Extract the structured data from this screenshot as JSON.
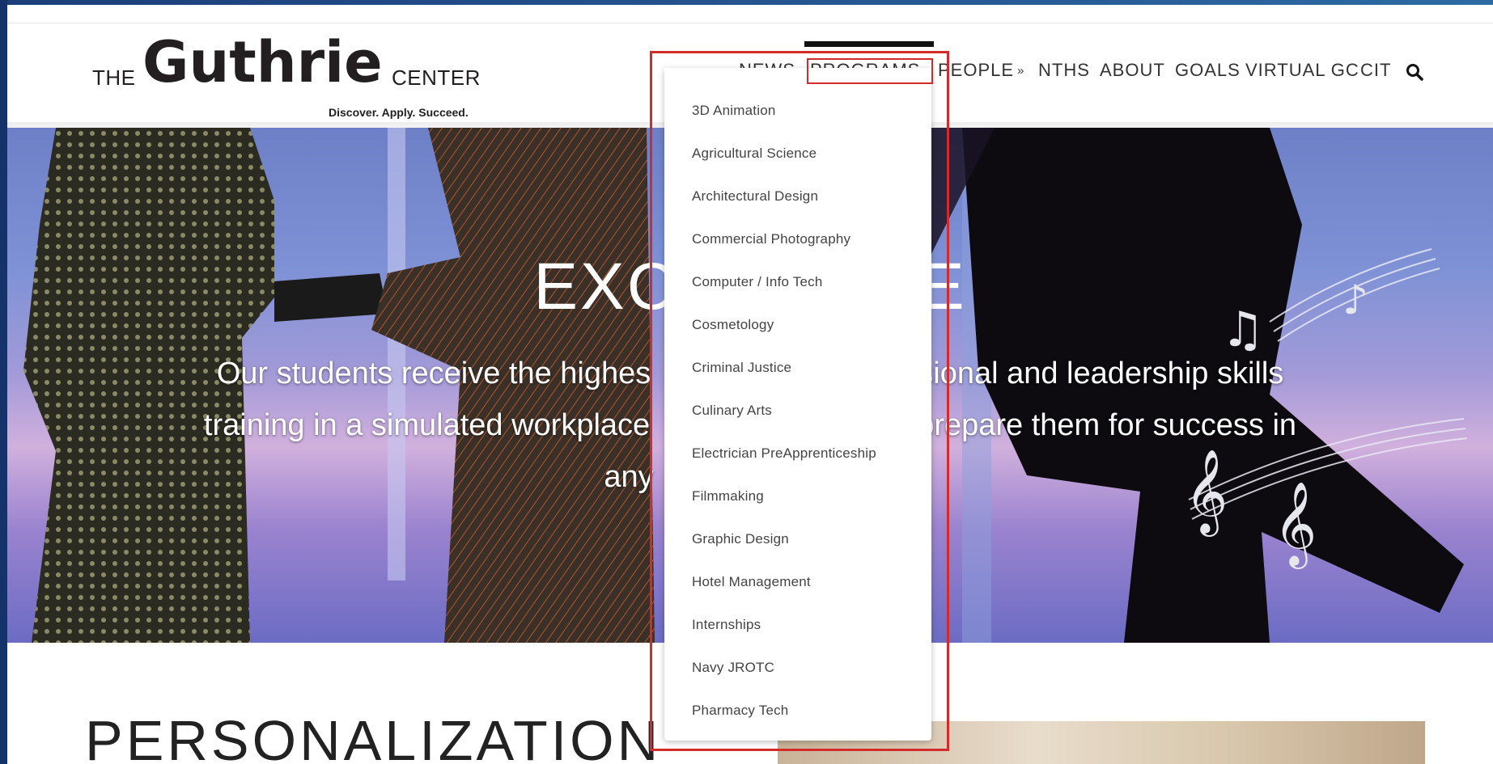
{
  "logo": {
    "the": "THE",
    "wordmark": "Guthrie",
    "center": "CENTER",
    "tagline": "Discover. Apply. Succeed."
  },
  "nav": {
    "items": [
      {
        "label": "NEWS",
        "has_menu": false
      },
      {
        "label": "PROGRAMS",
        "has_menu": true,
        "active": true
      },
      {
        "label": "PEOPLE",
        "has_menu": true
      },
      {
        "label": "NTHS",
        "has_menu": false
      },
      {
        "label": "ABOUT",
        "has_menu": false
      },
      {
        "label": "GOALS",
        "has_menu": false
      },
      {
        "label": "VIRTUAL GC",
        "has_menu": false
      },
      {
        "label": "CIT",
        "has_menu": false
      }
    ],
    "chevron": "»",
    "search_icon": "search-icon"
  },
  "hero": {
    "title_left": "EXC",
    "title_right": "E",
    "line1_left": "Our students receive the highes",
    "line1_right": "sional and leadership skills",
    "line2_left": "training in a simulated workplace",
    "line2_right": "prepare them for success in",
    "line3_left": "any"
  },
  "section": {
    "title": "PERSONALIZATION"
  },
  "programs_menu": {
    "items": [
      "3D Animation",
      "Agricultural Science",
      "Architectural Design",
      "Commercial Photography",
      "Computer / Info Tech",
      "Cosmetology",
      "Criminal Justice",
      "Culinary Arts",
      "Electrician PreApprenticeship",
      "Filmmaking",
      "Graphic Design",
      "Hotel Management",
      "Internships",
      "Navy JROTC",
      "Pharmacy Tech"
    ]
  },
  "colors": {
    "highlight": "#d32a2a",
    "frame": "#16326a",
    "text": "#333333"
  }
}
